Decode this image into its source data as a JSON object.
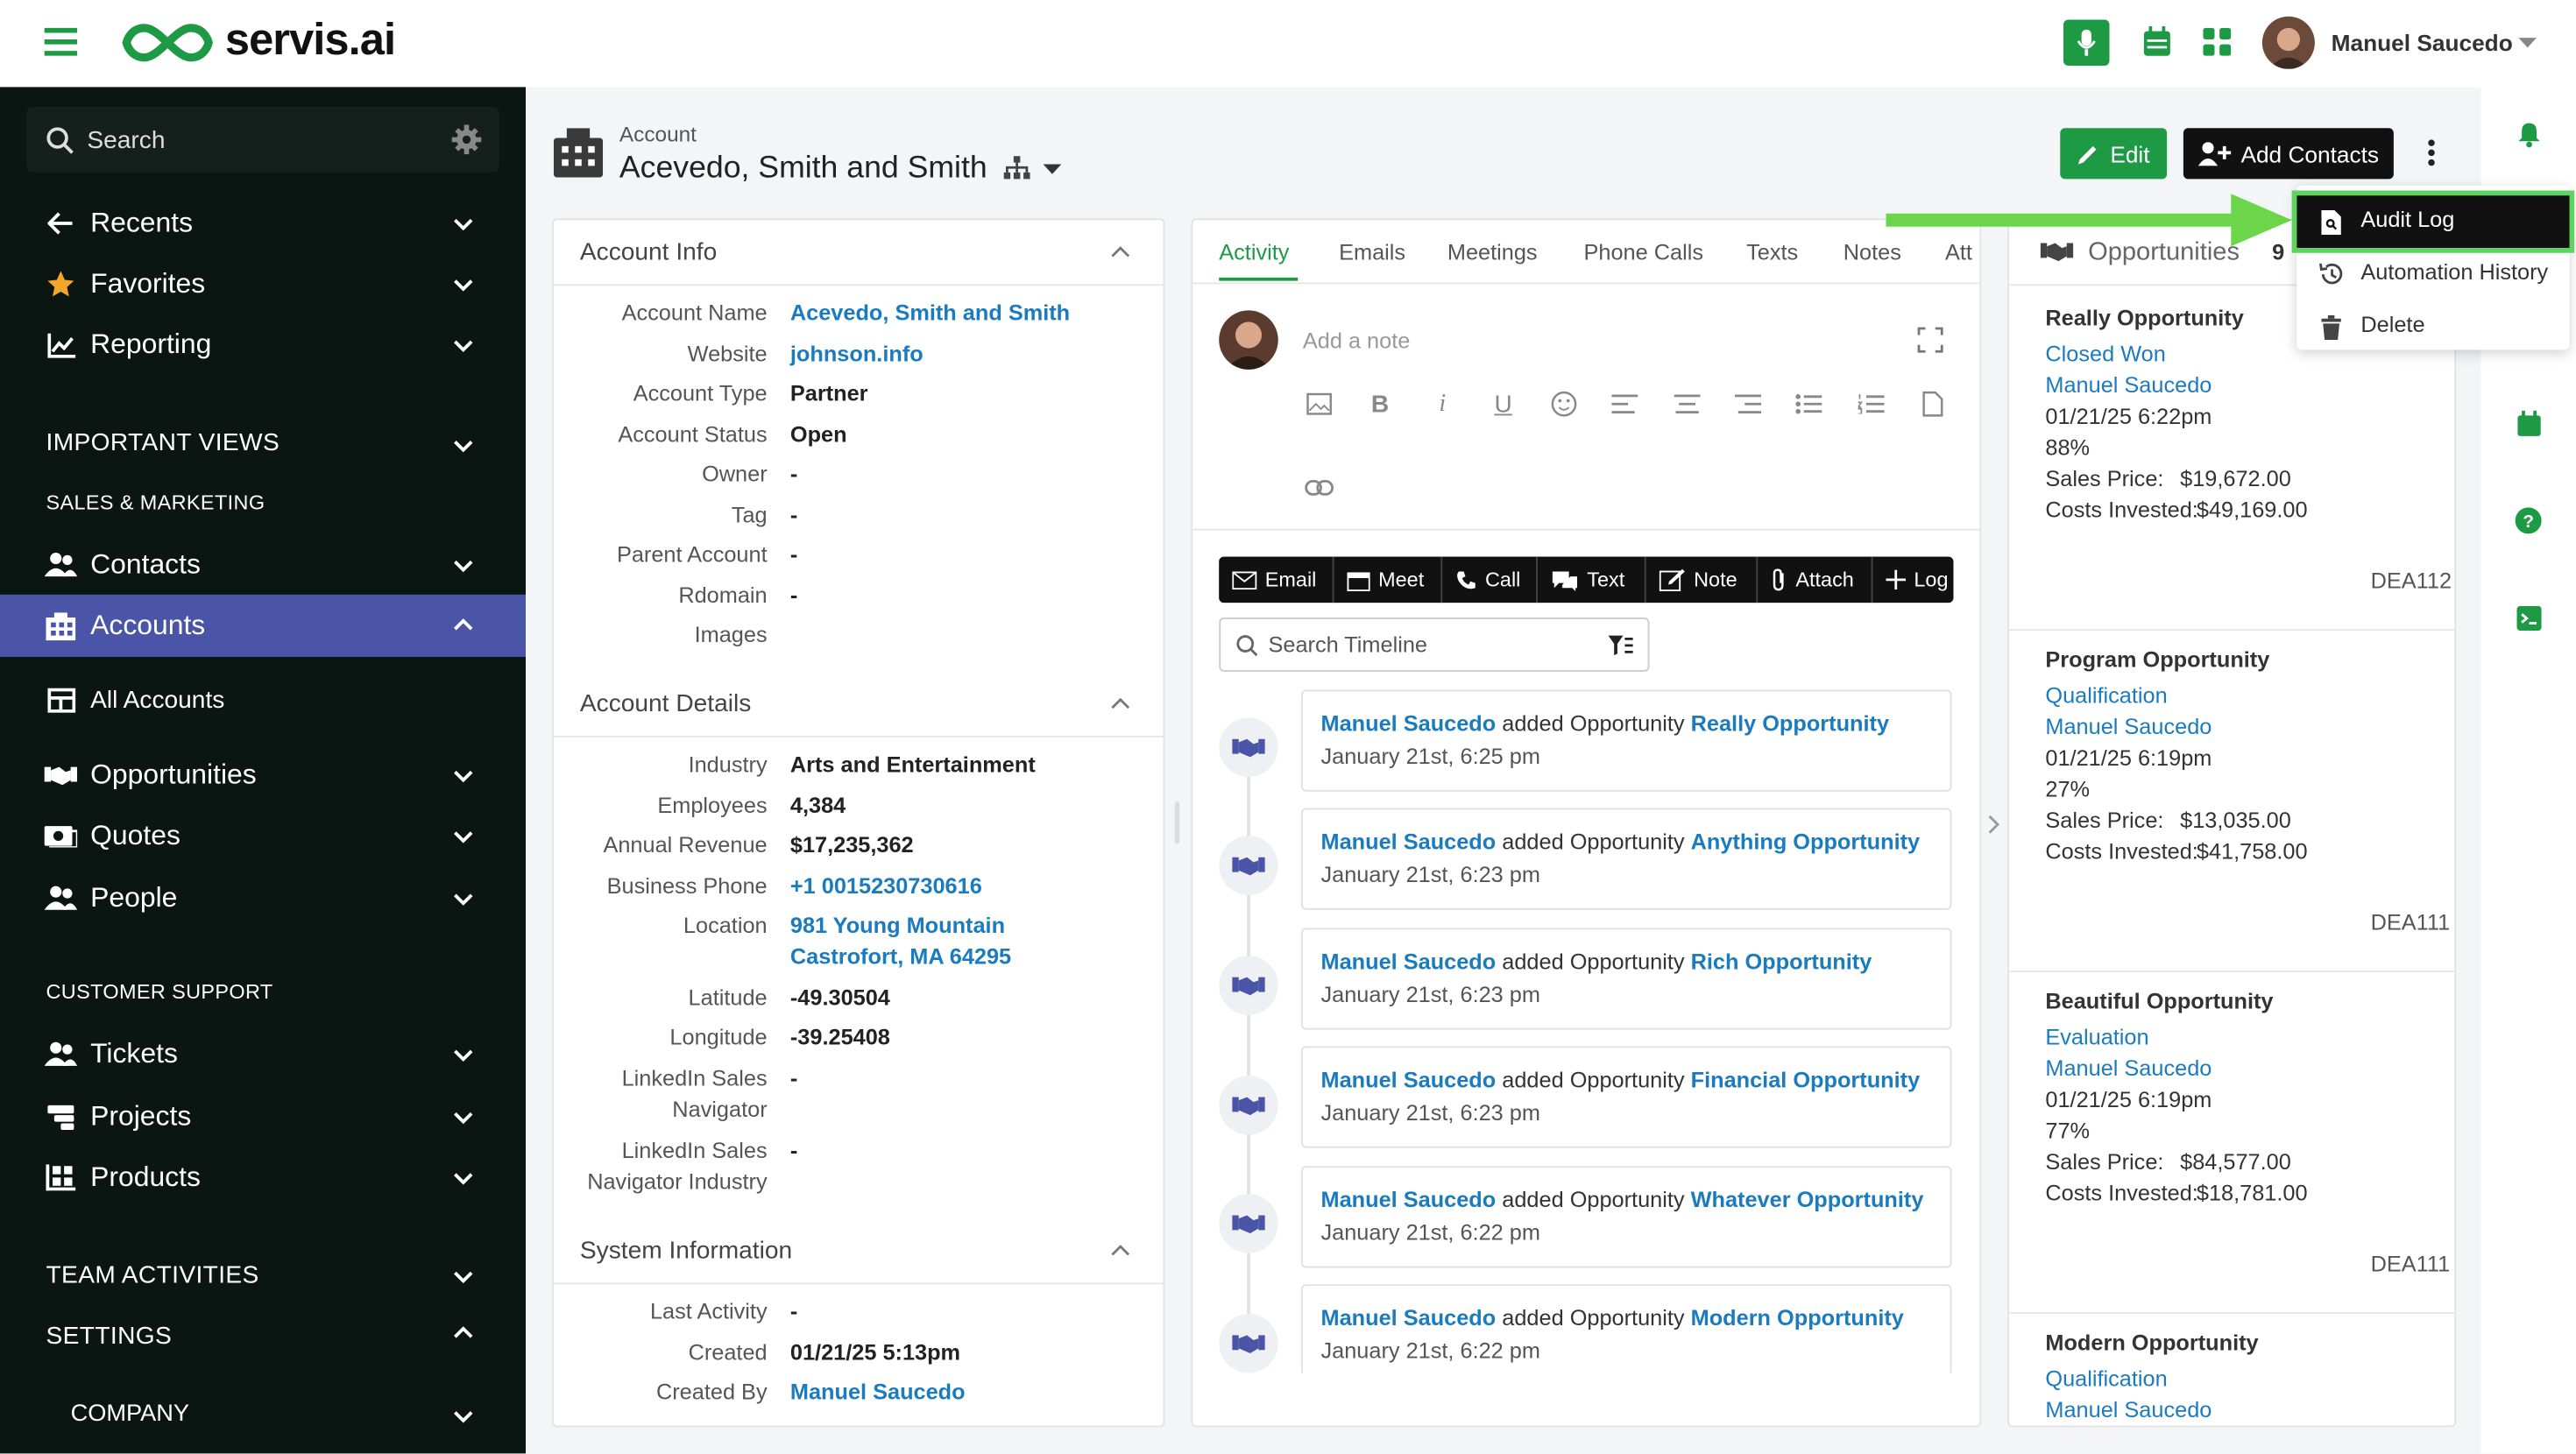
{
  "app": {
    "brand": "servis.ai",
    "accent": "#1e9a44",
    "nav_active": "#4a55a8"
  },
  "topbar": {
    "user_name": "Manuel Saucedo",
    "icons": [
      "microphone-icon",
      "calendar-icon",
      "apps-grid-icon"
    ]
  },
  "sidebar": {
    "search_label": "Search",
    "items": [
      {
        "label": "Recents",
        "icon": "arrow-left-icon"
      },
      {
        "label": "Favorites",
        "icon": "star-icon"
      },
      {
        "label": "Reporting",
        "icon": "chart-icon"
      }
    ],
    "important_views": "IMPORTANT VIEWS",
    "sales_marketing": "SALES & MARKETING",
    "sales_items": [
      {
        "label": "Contacts"
      },
      {
        "label": "Accounts"
      },
      {
        "label": "All Accounts"
      },
      {
        "label": "Opportunities"
      },
      {
        "label": "Quotes"
      },
      {
        "label": "People"
      }
    ],
    "customer_support": "CUSTOMER SUPPORT",
    "support_items": [
      {
        "label": "Tickets"
      },
      {
        "label": "Projects"
      },
      {
        "label": "Products"
      }
    ],
    "team_activities": "TEAM ACTIVITIES",
    "settings": "SETTINGS",
    "company": "COMPANY"
  },
  "header": {
    "small_label": "Account",
    "title": "Acevedo, Smith and Smith",
    "edit_label": "Edit",
    "add_contacts_label": "Add Contacts"
  },
  "account_info": {
    "title": "Account Info",
    "fields": [
      {
        "label": "Account Name",
        "value": "Acevedo, Smith and Smith"
      },
      {
        "label": "Website",
        "value": "johnson.info"
      },
      {
        "label": "Account Type",
        "value": "Partner"
      },
      {
        "label": "Account Status",
        "value": "Open"
      },
      {
        "label": "Owner",
        "value": "-"
      },
      {
        "label": "Tag",
        "value": "-"
      },
      {
        "label": "Parent Account",
        "value": "-"
      },
      {
        "label": "Rdomain",
        "value": "-"
      },
      {
        "label": "Images",
        "value": ""
      }
    ]
  },
  "account_details": {
    "title": "Account Details",
    "fields": [
      {
        "label": "Industry",
        "value": "Arts and Entertainment"
      },
      {
        "label": "Employees",
        "value": "4,384"
      },
      {
        "label": "Annual Revenue",
        "value": "$17,235,362"
      },
      {
        "label": "Business Phone",
        "value": "+1 0015230730616"
      },
      {
        "label": "Location",
        "value": "981 Young Mountain",
        "value2": "Castrofort, MA 64295"
      },
      {
        "label": "Latitude",
        "value": "-49.30504"
      },
      {
        "label": "Longitude",
        "value": "-39.25408"
      },
      {
        "label": "LinkedIn Sales",
        "label2": "Navigator",
        "value": "-"
      },
      {
        "label": "LinkedIn Sales",
        "label2": "Navigator Industry",
        "value": "-"
      }
    ]
  },
  "system_info": {
    "title": "System Information",
    "fields": [
      {
        "label": "Last Activity",
        "value": "-"
      },
      {
        "label": "Created",
        "value": "01/21/25 5:13pm"
      },
      {
        "label": "Created By",
        "value": "Manuel Saucedo"
      }
    ]
  },
  "activity": {
    "tabs": [
      "Activity",
      "Emails",
      "Meetings",
      "Phone Calls",
      "Texts",
      "Notes",
      "Att"
    ],
    "note_placeholder": "Add a note",
    "actions": [
      "Email",
      "Meet",
      "Call",
      "Text",
      "Note",
      "Attach",
      "Log"
    ],
    "search_placeholder": "Search Timeline",
    "timeline": [
      {
        "user": "Manuel Saucedo",
        "action": " added Opportunity ",
        "target": "Really Opportunity",
        "time": "January 21st, 6:25 pm"
      },
      {
        "user": "Manuel Saucedo",
        "action": " added Opportunity ",
        "target": "Anything Opportunity",
        "time": "January 21st, 6:23 pm"
      },
      {
        "user": "Manuel Saucedo",
        "action": " added Opportunity ",
        "target": "Rich Opportunity",
        "time": "January 21st, 6:23 pm"
      },
      {
        "user": "Manuel Saucedo",
        "action": " added Opportunity ",
        "target": "Financial Opportunity",
        "time": "January 21st, 6:23 pm"
      },
      {
        "user": "Manuel Saucedo",
        "action": " added Opportunity ",
        "target": "Whatever Opportunity",
        "time": "January 21st, 6:22 pm"
      },
      {
        "user": "Manuel Saucedo",
        "action": " added Opportunity ",
        "target": "Modern Opportunity",
        "time": "January 21st, 6:22 pm"
      }
    ]
  },
  "opportunities": {
    "title": "Opportunities",
    "count": "9",
    "items": [
      {
        "name": "Really Opportunity",
        "stage": "Closed Won",
        "owner": "Manuel Saucedo",
        "date": "01/21/25 6:22pm",
        "prob": "88%",
        "sales_label": "Sales Price:",
        "sales": "$19,672.00",
        "costs_label": "Costs Invested:",
        "costs": "$49,169.00",
        "code": "DEA112"
      },
      {
        "name": "Program Opportunity",
        "stage": "Qualification",
        "owner": "Manuel Saucedo",
        "date": "01/21/25 6:19pm",
        "prob": "27%",
        "sales_label": "Sales Price:",
        "sales": "$13,035.00",
        "costs_label": "Costs Invested:",
        "costs": "$41,758.00",
        "code": "DEA111"
      },
      {
        "name": "Beautiful Opportunity",
        "stage": "Evaluation",
        "owner": "Manuel Saucedo",
        "date": "01/21/25 6:19pm",
        "prob": "77%",
        "sales_label": "Sales Price:",
        "sales": "$84,577.00",
        "costs_label": "Costs Invested:",
        "costs": "$18,781.00",
        "code": "DEA111"
      },
      {
        "name": "Modern Opportunity",
        "stage": "Qualification",
        "owner": "Manuel Saucedo"
      }
    ]
  },
  "menu": {
    "items": [
      {
        "label": "Audit Log",
        "icon": "document-icon"
      },
      {
        "label": "Automation History",
        "icon": "history-icon"
      },
      {
        "label": "Delete",
        "icon": "trash-icon"
      }
    ]
  }
}
